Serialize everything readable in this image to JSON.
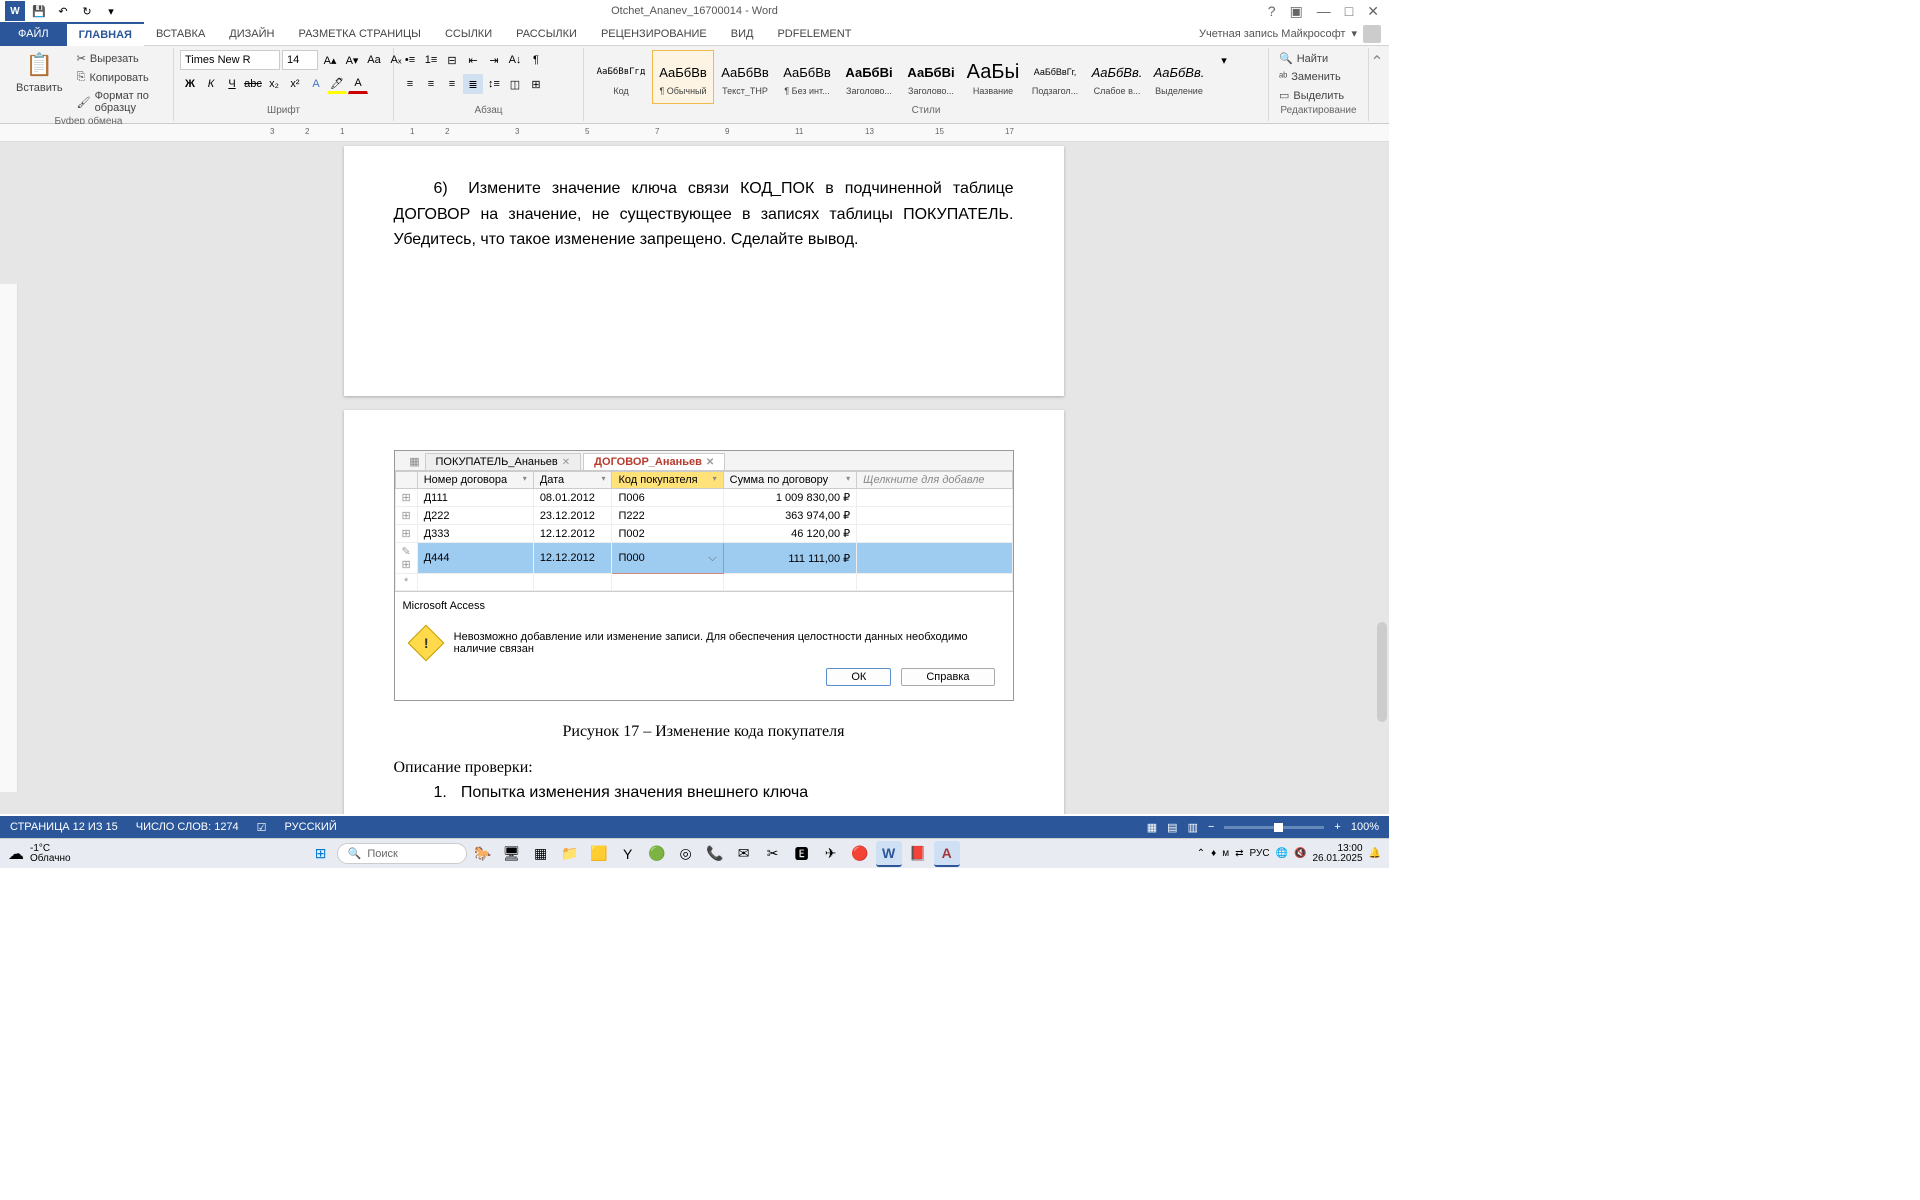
{
  "title": "Otchet_Ananev_16700014 - Word",
  "tabs": {
    "file": "ФАЙЛ",
    "home": "ГЛАВНАЯ",
    "insert": "ВСТАВКА",
    "design": "ДИЗАЙН",
    "layout": "РАЗМЕТКА СТРАНИЦЫ",
    "references": "ССЫЛКИ",
    "mailings": "РАССЫЛКИ",
    "review": "РЕЦЕНЗИРОВАНИЕ",
    "view": "ВИД",
    "pdf": "PDFelement"
  },
  "account": "Учетная запись Майкрософт",
  "ribbon": {
    "paste": "Вставить",
    "cut": "Вырезать",
    "copy": "Копировать",
    "format": "Формат по образцу",
    "clipboard_group": "Буфер обмена",
    "font": "Times New R",
    "fontsize": "14",
    "font_group": "Шрифт",
    "para_group": "Абзац",
    "styles_group": "Стили",
    "editing_group": "Редактирование",
    "find": "Найти",
    "replace": "Заменить",
    "select": "Выделить"
  },
  "styles": [
    {
      "preview": "АаБбВвГгд",
      "name": "Код"
    },
    {
      "preview": "АаБбВв",
      "name": "¶ Обычный"
    },
    {
      "preview": "АаБбВв",
      "name": "Текст_ТНР"
    },
    {
      "preview": "АаБбВв",
      "name": "¶ Без инт..."
    },
    {
      "preview": "АаБбВі",
      "name": "Заголово..."
    },
    {
      "preview": "АаБбВі",
      "name": "Заголово..."
    },
    {
      "preview": "АаБьі",
      "name": "Название"
    },
    {
      "preview": "АаБбВвГг,",
      "name": "Подзагол..."
    },
    {
      "preview": "АаБбВв.",
      "name": "Слабое в..."
    },
    {
      "preview": "АаБбВв.",
      "name": "Выделение"
    }
  ],
  "doc": {
    "item6": "Измените значение ключа связи КОД_ПОК в подчиненной таблице ДОГОВОР на значение, не существующее в записях таблицы ПОКУПАТЕЛЬ. Убедитесь, что такое изменение запрещено. Сделайте вывод.",
    "item6_num": "6)",
    "fig_caption": "Рисунок 17 – Изменение кода покупателя",
    "desc_title": "Описание проверки:",
    "desc_1_num": "1.",
    "desc_1": "Попытка изменения значения внешнего ключа"
  },
  "access": {
    "tab1": "ПОКУПАТЕЛЬ_Ананьев",
    "tab2": "ДОГОВОР_Ананьев",
    "headers": {
      "num": "Номер договора",
      "date": "Дата",
      "buyer": "Код покупателя",
      "sum": "Сумма по договору",
      "add": "Щелкните для добавле"
    },
    "rows": [
      {
        "num": "Д111",
        "date": "08.01.2012",
        "buyer": "П006",
        "sum": "1 009 830,00 ₽"
      },
      {
        "num": "Д222",
        "date": "23.12.2012",
        "buyer": "П222",
        "sum": "363 974,00 ₽"
      },
      {
        "num": "Д333",
        "date": "12.12.2012",
        "buyer": "П002",
        "sum": "46 120,00 ₽"
      },
      {
        "num": "Д444",
        "date": "12.12.2012",
        "buyer": "П000",
        "sum": "111 111,00 ₽"
      }
    ],
    "msg_title": "Microsoft Access",
    "msg_text": "Невозможно добавление или изменение записи. Для обеспечения целостности данных необходимо наличие связан",
    "ok": "ОК",
    "help": "Справка"
  },
  "status": {
    "page": "СТРАНИЦА 12 ИЗ 15",
    "words": "ЧИСЛО СЛОВ: 1274",
    "lang": "РУССКИЙ",
    "zoom": "100%"
  },
  "taskbar": {
    "temp": "-1°C",
    "weather": "Облачно",
    "search": "Поиск",
    "time": "13:00",
    "date": "26.01.2025",
    "lang": "РУС"
  }
}
